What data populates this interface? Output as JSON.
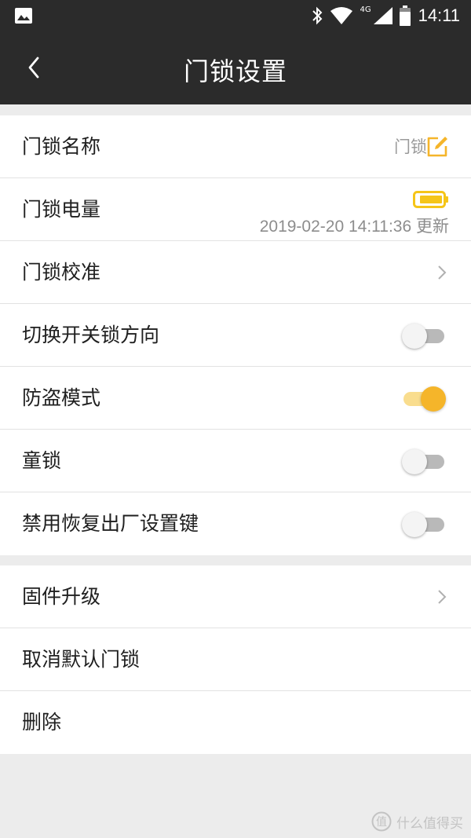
{
  "status_bar": {
    "network_label": "4G",
    "time": "14:11",
    "icons": [
      "image-icon",
      "bluetooth-icon",
      "wifi-icon",
      "cell-signal-icon",
      "battery-icon"
    ]
  },
  "header": {
    "title": "门锁设置",
    "back_icon": "chevron-left-icon"
  },
  "settings": {
    "lock_name": {
      "label": "门锁名称",
      "value": "门锁",
      "action_icon": "edit-icon"
    },
    "lock_battery": {
      "label": "门锁电量",
      "updated": "2019-02-20 14:11:36 更新",
      "level_icon": "battery-full-icon"
    },
    "lock_calibration": {
      "label": "门锁校准"
    },
    "switch_direction": {
      "label": "切换开关锁方向",
      "enabled": false
    },
    "anti_theft": {
      "label": "防盗模式",
      "enabled": true
    },
    "child_lock": {
      "label": "童锁",
      "enabled": false
    },
    "disable_reset_key": {
      "label": "禁用恢复出厂设置键",
      "enabled": false
    }
  },
  "actions": {
    "firmware_upgrade": {
      "label": "固件升级"
    },
    "cancel_default_lock": {
      "label": "取消默认门锁"
    },
    "delete": {
      "label": "删除"
    }
  },
  "colors": {
    "header_bg": "#2b2b2b",
    "accent": "#f5b52a",
    "page_bg": "#ececec"
  },
  "watermark": {
    "text": "什么值得买"
  }
}
